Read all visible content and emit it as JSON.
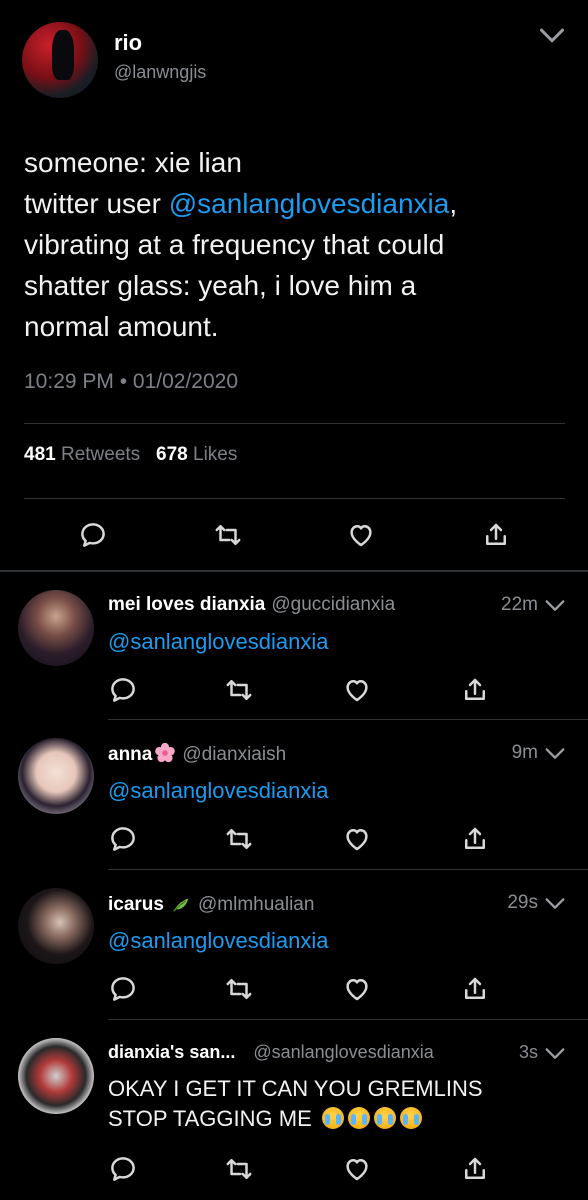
{
  "main_tweet": {
    "name": "rio",
    "handle": "@lanwngjis",
    "text_lines": [
      {
        "pre": "someone: xie lian",
        "mention": "",
        "post": ""
      },
      {
        "pre": "twitter user ",
        "mention": "@sanlanglovesdianxia",
        "post": ","
      },
      {
        "pre": "vibrating at a frequency that could",
        "mention": "",
        "post": ""
      },
      {
        "pre": "shatter glass: yeah, i love him a",
        "mention": "",
        "post": ""
      },
      {
        "pre": "normal amount.",
        "mention": "",
        "post": ""
      }
    ],
    "timestamp": "10:29 PM • 01/02/2020",
    "retweets_count": "481",
    "retweets_label": "Retweets",
    "likes_count": "678",
    "likes_label": "Likes"
  },
  "replies": [
    {
      "name": "mei loves dianxia",
      "handle": "@guccidianxia",
      "time": "22m",
      "text": "@sanlanglovesdianxia",
      "text_is_mention": true,
      "name_icon": ""
    },
    {
      "name": "anna",
      "handle": "@dianxiaish",
      "time": "9m",
      "text": "@sanlanglovesdianxia",
      "text_is_mention": true,
      "name_icon": "cherry-blossom-icon"
    },
    {
      "name": "icarus",
      "handle": "@mlmhualian",
      "time": "29s",
      "text": "@sanlanglovesdianxia",
      "text_is_mention": true,
      "name_icon": "herb-leaf-icon"
    },
    {
      "name": "dianxia's san...",
      "handle": "@sanlanglovesdianxia",
      "time": "3s",
      "text_line1": "OKAY I GET IT CAN YOU GREMLINS",
      "text_line2": "STOP TAGGING ME",
      "text_is_mention": false,
      "emoji_count": 4
    }
  ],
  "colors": {
    "background": "#000000",
    "mention": "#1d9bf0",
    "secondary_text": "#8a8e93",
    "divider": "#2f3336"
  },
  "icons": [
    "reply-icon",
    "retweet-icon",
    "like-icon",
    "share-icon",
    "chevron-down-icon",
    "loudly-crying-face-emoji"
  ]
}
